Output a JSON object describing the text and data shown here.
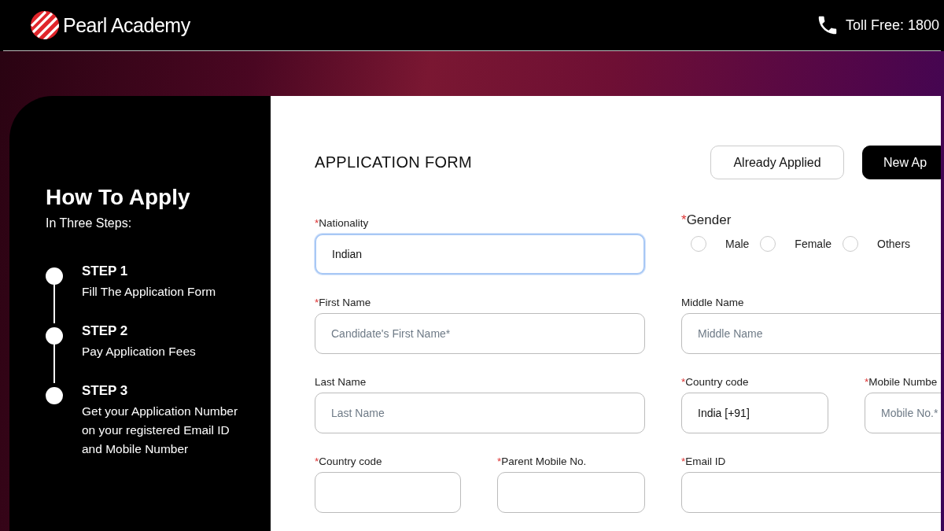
{
  "header": {
    "brand": "Pearl Academy",
    "contact": "Toll Free: 1800"
  },
  "steps_panel": {
    "title": "How To Apply",
    "subtitle": "In Three Steps:",
    "steps": [
      {
        "label": "STEP 1",
        "text": "Fill The Application Form"
      },
      {
        "label": "STEP 2",
        "text": "Pay Application Fees"
      },
      {
        "label": "STEP 3",
        "text": "Get your Application Number on your registered Email ID and Mobile Number"
      }
    ]
  },
  "form": {
    "title": "APPLICATION FORM",
    "buttons": [
      {
        "label": "Already Applied",
        "selected": false
      },
      {
        "label": "New Ap",
        "selected": true
      }
    ],
    "fields": [
      {
        "kind": "text",
        "label": "Nationality",
        "required_mark": "*",
        "value": "Indian",
        "focused": true
      },
      {
        "kind": "radio_group",
        "label": "Gender",
        "required_mark": "*",
        "options": [
          {
            "label": "Male",
            "selected": false
          },
          {
            "label": "Female",
            "selected": false
          },
          {
            "label": "Others",
            "selected": false
          }
        ]
      },
      {
        "kind": "text",
        "label": "First Name",
        "required_mark": "*",
        "placeholder": "Candidate's First Name*",
        "focused": false
      },
      {
        "kind": "text",
        "label": "Middle Name",
        "placeholder": "Middle Name",
        "focused": false
      },
      {
        "kind": "text",
        "label": "Last Name",
        "placeholder": "Last Name",
        "focused": false
      },
      {
        "kind": "text",
        "label": "Country code",
        "required_mark": "*",
        "value": "India [+91]",
        "focused": false
      },
      {
        "kind": "text",
        "label": "Mobile Numbe",
        "required_mark": "*",
        "placeholder": "Mobile No.*",
        "focused": false
      },
      {
        "kind": "text",
        "label": "Country code",
        "required_mark": "*",
        "focused": false
      },
      {
        "kind": "text",
        "label": "Parent Mobile No.",
        "required_mark": "*",
        "focused": false
      },
      {
        "kind": "text",
        "label": "Email ID",
        "required_mark": "*",
        "focused": false
      }
    ]
  }
}
